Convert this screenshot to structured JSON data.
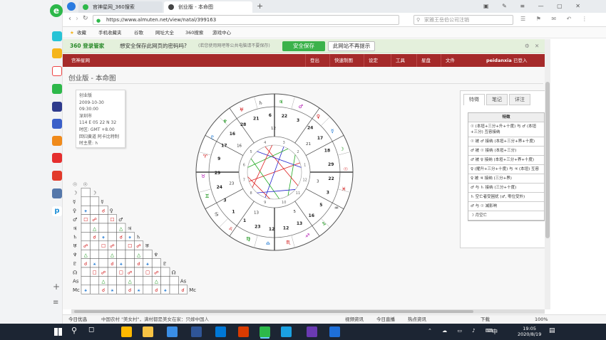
{
  "browser": {
    "tabs": [
      {
        "label": "官神星网_360搜索"
      },
      {
        "label": "创业版 - 本命图"
      }
    ],
    "url": "https://www.almuten.net/view/natal/399163",
    "search_placeholder": "家雅王岳伯公司注销",
    "favorites": [
      "收藏",
      "手机收藏夹",
      "谷歌",
      "网址大全",
      "360搜索",
      "游戏中心"
    ],
    "notify_text": "想安全保存此网页的密码吗?",
    "notify_small": "(若您使用网吧等公共电脑请不要保存)",
    "notify_brand": "360 登录管家",
    "save_btn": "安全保存",
    "nosave_btn": "此网站不再提示"
  },
  "site": {
    "logo": "宫神星网",
    "nav": [
      "登出",
      "快速制图",
      "设定",
      "工具",
      "星盘",
      "文件"
    ],
    "user": "peidanxia",
    "user_suffix": "已登入",
    "page_title": "创业版 - 本命图"
  },
  "chart_info": {
    "name": "创业版",
    "datetime": "2009-10-30 09:30:00",
    "place": "深圳市",
    "coords": "114 E 05  22 N 32",
    "timezone": "时区: GMT +8.00",
    "house_system": "回归黄道 阿卡比特制",
    "ruler": "时主星: ♄"
  },
  "wheel": {
    "outer_degrees": [
      "29",
      "18",
      "17",
      "24",
      "3",
      "22",
      "6",
      "21",
      "28",
      "16",
      "17",
      "9",
      "29",
      "24",
      "3",
      "1",
      "1",
      "23",
      "12",
      "12",
      "13",
      "16",
      "5",
      "3",
      "22"
    ],
    "house_numbers": [
      "1",
      "2",
      "3",
      "4",
      "5",
      "6",
      "7",
      "8",
      "9",
      "10",
      "11",
      "12"
    ],
    "inner_degrees": [
      "21",
      "12",
      "16",
      "23",
      "13",
      "5",
      "3"
    ]
  },
  "panel": {
    "tabs": [
      "特徵",
      "笔记",
      "详注"
    ],
    "header": "特徵",
    "rows": [
      "☉ (本垣+三分+升+十度) 与 ♂ (本垣+三分) 互容接纳",
      "☉ 被 ♂ 接纳 (本垣+三分+界+十度)",
      "♂ 被 ☉ 接纳 (本垣+三分)",
      "♂ 被 ♀ 接纳 (本垣+三分+界+十度)",
      "♀ (擢升+三分+十度) 与 ♃ (本垣) 互容",
      "♀ 被 ♃ 接纳 (三分+界)",
      "♂ 与 ♄ 接纳 (三分+十度)",
      "♄ 空亡者受困扰 (♂, 零位受外)",
      "♂ 与 ☉ 减影响",
      "☽ 月空亡"
    ]
  },
  "status": {
    "left": "今日优选",
    "news1": "中国农村 \"美女村\"，满村都是美女在家：只嫁中国人",
    "middle": [
      "视频资讯",
      "今日直播",
      "热点资讯"
    ],
    "right": [
      "下载",
      "100%"
    ]
  },
  "taskbar": {
    "time": "19:05",
    "date": "2020/8/19",
    "ime": "中"
  },
  "colors": {
    "nav": "#a52a2a",
    "notify": "#e4f0dc",
    "save": "#3bb24a",
    "taskbar": "#1c2533"
  }
}
